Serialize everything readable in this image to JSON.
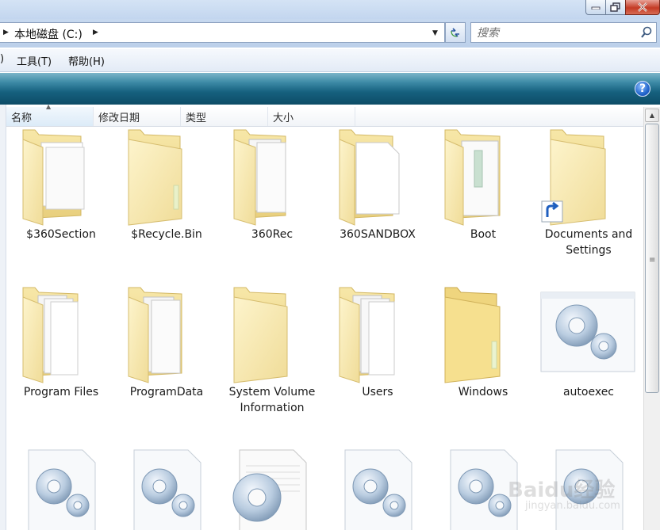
{
  "address": {
    "path": "本地磁盘 (C:)"
  },
  "search": {
    "placeholder": "搜索"
  },
  "menu": {
    "items": [
      {
        "label": "工具(T)"
      },
      {
        "label": "帮助(H)"
      }
    ],
    "partial_left": ")"
  },
  "columns": [
    {
      "label": "名称"
    },
    {
      "label": "修改日期"
    },
    {
      "label": "类型"
    },
    {
      "label": "大小"
    }
  ],
  "items": [
    {
      "name": "$360Section",
      "icon": "folder-documents-icon"
    },
    {
      "name": "$Recycle.Bin",
      "icon": "folder-empty-icon"
    },
    {
      "name": "360Rec",
      "icon": "folder-documents-icon"
    },
    {
      "name": "360SANDBOX",
      "icon": "folder-page-icon"
    },
    {
      "name": "Boot",
      "icon": "folder-documents-icon"
    },
    {
      "name": "Documents and Settings",
      "icon": "folder-shortcut-icon"
    },
    {
      "name": "Program Files",
      "icon": "folder-documents-icon"
    },
    {
      "name": "ProgramData",
      "icon": "folder-documents-icon"
    },
    {
      "name": "System Volume Information",
      "icon": "folder-empty-icon"
    },
    {
      "name": "Users",
      "icon": "folder-documents-icon"
    },
    {
      "name": "Windows",
      "icon": "folder-empty-icon"
    },
    {
      "name": "autoexec",
      "icon": "system-file-gears-icon"
    }
  ],
  "partial_row_icons": [
    "system-file-gears-icon",
    "system-file-gears-icon",
    "text-file-gear-icon",
    "system-file-gears-icon",
    "system-file-gears-icon",
    "system-file-gears-icon"
  ],
  "watermark": {
    "logo": "Baidu经验",
    "sub": "jingyan.baidu.com"
  },
  "colors": {
    "command_bar": "#16617f",
    "folder_yellow": "#f6e6a6",
    "address_bar": "#c6d8ef"
  }
}
